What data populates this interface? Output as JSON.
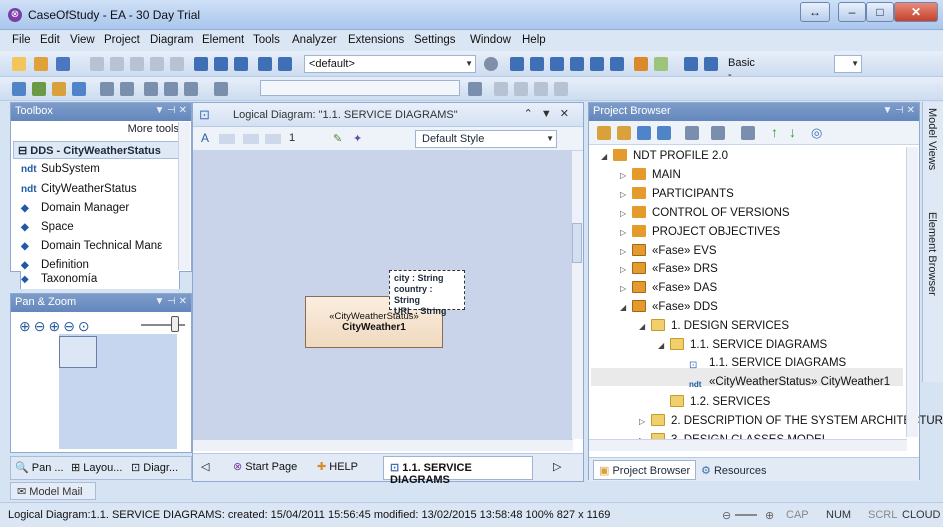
{
  "window": {
    "title": "CaseOfStudy - EA - 30 Day Trial"
  },
  "menu": [
    "File",
    "Edit",
    "View",
    "Project",
    "Diagram",
    "Element",
    "Tools",
    "Analyzer",
    "Extensions",
    "Settings",
    "Window",
    "Help"
  ],
  "toolbar": {
    "profile_combo": "<default>",
    "workspace_combo": "Basic - Normal"
  },
  "toolbox": {
    "title": "Toolbox",
    "more_tools": "More tools",
    "group": "DDS - CityWeatherStatus",
    "items": [
      "SubSystem",
      "CityWeatherStatus",
      "Domain Manager",
      "Space",
      "Domain Technical Manε",
      "Definition",
      "Taxonomía"
    ]
  },
  "panzoom": {
    "title": "Pan & Zoom"
  },
  "left_tabs": [
    "Pan ...",
    "Layou...",
    "Diagr..."
  ],
  "diagram": {
    "title": "Logical Diagram: \"1.1. SERVICE DIAGRAMS\"",
    "style": "Default Style",
    "zoom_value": "1",
    "class_stereotype": "«CityWeatherStatus»",
    "class_name": "CityWeather1",
    "attributes": [
      "city : String",
      "country : String",
      "URL : String"
    ],
    "tabs": [
      "Start Page",
      "HELP",
      "1.1. SERVICE DIAGRAMS"
    ]
  },
  "project": {
    "title": "Project Browser",
    "tree": [
      {
        "label": "NDT PROFILE 2.0",
        "indent": 0,
        "twisty": "◢",
        "icon": "pkg"
      },
      {
        "label": "MAIN",
        "indent": 1,
        "twisty": "▷",
        "icon": "pkg"
      },
      {
        "label": "PARTICIPANTS",
        "indent": 1,
        "twisty": "▷",
        "icon": "pkg"
      },
      {
        "label": "CONTROL OF VERSIONS",
        "indent": 1,
        "twisty": "▷",
        "icon": "pkg"
      },
      {
        "label": "PROJECT OBJECTIVES",
        "indent": 1,
        "twisty": "▷",
        "icon": "pkg"
      },
      {
        "label": "«Fase» EVS",
        "indent": 1,
        "twisty": "▷",
        "icon": "fase"
      },
      {
        "label": "«Fase» DRS",
        "indent": 1,
        "twisty": "▷",
        "icon": "fase"
      },
      {
        "label": "«Fase» DAS",
        "indent": 1,
        "twisty": "▷",
        "icon": "fase"
      },
      {
        "label": "«Fase» DDS",
        "indent": 1,
        "twisty": "◢",
        "icon": "fase"
      },
      {
        "label": "1. DESIGN SERVICES",
        "indent": 2,
        "twisty": "◢",
        "icon": "folder"
      },
      {
        "label": "1.1. SERVICE DIAGRAMS",
        "indent": 3,
        "twisty": "◢",
        "icon": "folder"
      },
      {
        "label": "1.1. SERVICE DIAGRAMS",
        "indent": 4,
        "twisty": "",
        "icon": "diag"
      },
      {
        "label": "«CityWeatherStatus» CityWeather1",
        "indent": 4,
        "twisty": "",
        "icon": "elem"
      },
      {
        "label": "1.2. SERVICES",
        "indent": 3,
        "twisty": "",
        "icon": "folder"
      },
      {
        "label": "2. DESCRIPTION OF THE SYSTEM ARCHITECTUR",
        "indent": 2,
        "twisty": "▷",
        "icon": "folder"
      },
      {
        "label": "3. DESIGN CLASSES MODEL",
        "indent": 2,
        "twisty": "▷",
        "icon": "folder"
      }
    ],
    "tabs": [
      "Project Browser",
      "Resources"
    ]
  },
  "right_tabs": [
    "Model Views",
    "Element Browser"
  ],
  "model_mail": "Model Mail",
  "status": {
    "text": "Logical Diagram:1.1. SERVICE DIAGRAMS:  created: 15/04/2011 15:56:45  modified: 13/02/2015 13:58:48  100%  827 x 1169",
    "indicators": [
      "CAP",
      "NUM",
      "SCRL",
      "CLOUD"
    ]
  }
}
